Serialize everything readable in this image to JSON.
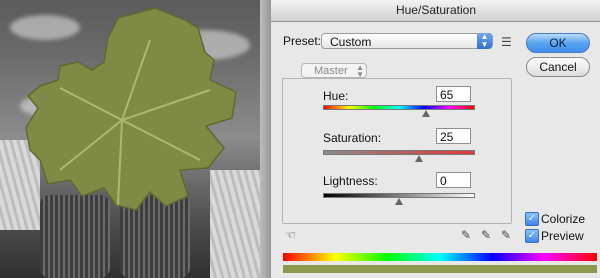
{
  "window": {
    "title": "Hue/Saturation"
  },
  "preset": {
    "label": "Preset:",
    "value": "Custom"
  },
  "buttons": {
    "ok": "OK",
    "cancel": "Cancel"
  },
  "channel": {
    "value": "Master"
  },
  "hue": {
    "label": "Hue:",
    "value": "65",
    "level_fraction": 0.68
  },
  "saturation": {
    "label": "Saturation:",
    "value": "25",
    "level_fraction": 0.63
  },
  "lightness": {
    "label": "Lightness:",
    "value": "0",
    "level_fraction": 0.5
  },
  "options": {
    "colorize_label": "Colorize",
    "colorize_checked": true,
    "preview_label": "Preview",
    "preview_checked": true
  },
  "colors": {
    "accent": "#3f8ff0",
    "leaf_green": "#8c9a4e",
    "titlebar": "#d9d9d9"
  },
  "icons": {
    "preset_options": "preset-options-icon",
    "targeted_adjust": "hand-icon",
    "eyedroppers": [
      "eyedropper-icon",
      "eyedropper-plus-icon",
      "eyedropper-minus-icon"
    ]
  }
}
